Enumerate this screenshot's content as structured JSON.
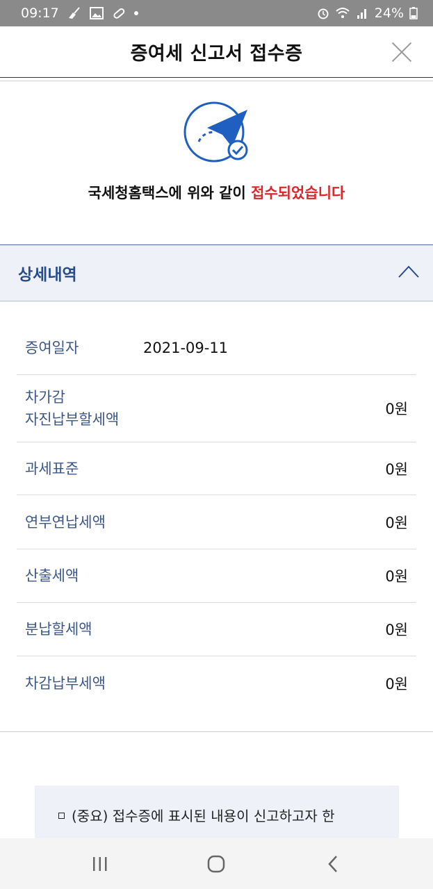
{
  "status_bar": {
    "time": "09:17",
    "battery": "24%"
  },
  "header": {
    "title": "증여세 신고서 접수증"
  },
  "confirmation": {
    "message_prefix": "국세청홈택스에 위와 같이 ",
    "message_highlight": "접수되었습니다",
    "highlight_color": "#d9262b"
  },
  "details": {
    "title": "상세내역",
    "rows": [
      {
        "label": "증여일자",
        "value": "2021-09-11"
      },
      {
        "label_line1": "차가감",
        "label_line2": "자진납부할세액",
        "value": "0원"
      },
      {
        "label": "과세표준",
        "value": "0원"
      },
      {
        "label": "연부연납세액",
        "value": "0원"
      },
      {
        "label": "산출세액",
        "value": "0원"
      },
      {
        "label": "분납할세액",
        "value": "0원"
      },
      {
        "label": "차감납부세액",
        "value": "0원"
      }
    ]
  },
  "notice": {
    "text": "(중요) 접수증에 표시된 내용이 신고하고자 한"
  },
  "colors": {
    "accent_blue": "#264c8c",
    "label_blue": "#3c5789",
    "icon_blue": "#1f5fbf"
  }
}
